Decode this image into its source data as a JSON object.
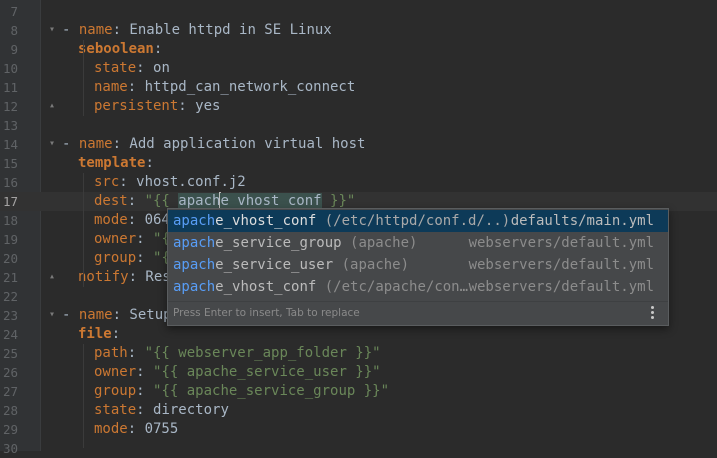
{
  "editor": {
    "lines": [
      {
        "n": "7"
      },
      {
        "n": "8",
        "text": [
          [
            "dash",
            "- "
          ],
          [
            "key",
            "name"
          ],
          [
            "val",
            ": Enable httpd in SE Linux"
          ]
        ]
      },
      {
        "n": "9",
        "text": [
          [
            "kbold",
            "seboolean"
          ],
          [
            "val",
            ":"
          ]
        ]
      },
      {
        "n": "10",
        "text": [
          [
            "key",
            "state"
          ],
          [
            "val",
            ": on"
          ]
        ]
      },
      {
        "n": "11",
        "text": [
          [
            "key",
            "name"
          ],
          [
            "val",
            ": httpd_can_network_connect"
          ]
        ]
      },
      {
        "n": "12",
        "text": [
          [
            "key",
            "persistent"
          ],
          [
            "val",
            ": yes"
          ]
        ]
      },
      {
        "n": "13"
      },
      {
        "n": "14",
        "text": [
          [
            "dash",
            "- "
          ],
          [
            "key",
            "name"
          ],
          [
            "val",
            ": Add application virtual host"
          ]
        ]
      },
      {
        "n": "15",
        "text": [
          [
            "kbold",
            "template"
          ],
          [
            "val",
            ":"
          ]
        ]
      },
      {
        "n": "16",
        "text": [
          [
            "key",
            "src"
          ],
          [
            "val",
            ": vhost.conf.j2"
          ]
        ]
      },
      {
        "n": "17",
        "text": [
          [
            "key",
            "dest"
          ],
          [
            "val",
            ": "
          ],
          [
            "str",
            "\"{{ "
          ],
          [
            "hl",
            "apach"
          ],
          [
            "caret",
            ""
          ],
          [
            "hl",
            "e_vhost_conf"
          ],
          [
            "str",
            " }}\""
          ]
        ]
      },
      {
        "n": "18",
        "text": [
          [
            "key",
            "mode"
          ],
          [
            "val",
            ": 064"
          ]
        ]
      },
      {
        "n": "19",
        "text": [
          [
            "key",
            "owner"
          ],
          [
            "val",
            ": "
          ],
          [
            "str",
            "\"{"
          ]
        ]
      },
      {
        "n": "20",
        "text": [
          [
            "key",
            "group"
          ],
          [
            "val",
            ": "
          ],
          [
            "str",
            "\"{"
          ]
        ]
      },
      {
        "n": "21",
        "text": [
          [
            "key",
            "notify"
          ],
          [
            "val",
            ": Res"
          ]
        ]
      },
      {
        "n": "22"
      },
      {
        "n": "23",
        "text": [
          [
            "dash",
            "- "
          ],
          [
            "key",
            "name"
          ],
          [
            "val",
            ": Setup"
          ]
        ]
      },
      {
        "n": "24",
        "text": [
          [
            "kbold",
            "file"
          ],
          [
            "val",
            ":"
          ]
        ]
      },
      {
        "n": "25",
        "text": [
          [
            "key",
            "path"
          ],
          [
            "val",
            ": "
          ],
          [
            "str",
            "\"{{ webserver_app_folder }}\""
          ]
        ]
      },
      {
        "n": "26",
        "text": [
          [
            "key",
            "owner"
          ],
          [
            "val",
            ": "
          ],
          [
            "str",
            "\"{{ apache_service_user }}\""
          ]
        ]
      },
      {
        "n": "27",
        "text": [
          [
            "key",
            "group"
          ],
          [
            "val",
            ": "
          ],
          [
            "str",
            "\"{{ apache_service_group }}\""
          ]
        ]
      },
      {
        "n": "28",
        "text": [
          [
            "key",
            "state"
          ],
          [
            "val",
            ": directory"
          ]
        ]
      },
      {
        "n": "29",
        "text": [
          [
            "key",
            "mode"
          ],
          [
            "val",
            ": 0755"
          ]
        ]
      },
      {
        "n": "30"
      }
    ]
  },
  "autocomplete": {
    "typed_prefix": "apach",
    "items": [
      {
        "match": "apach",
        "rest": "e_vhost_conf",
        "tail": "(/etc/httpd/conf.d/..)",
        "source": "defaults/main.yml",
        "selected": true
      },
      {
        "match": "apach",
        "rest": "e_service_group",
        "tail": "(apache)",
        "source": "webservers/default.yml",
        "selected": false
      },
      {
        "match": "apach",
        "rest": "e_service_user",
        "tail": "(apache)",
        "source": "webservers/default.yml",
        "selected": false
      },
      {
        "match": "apach",
        "rest": "e_vhost_conf",
        "tail": "(/etc/apache/con…",
        "source": "webservers/default.yml",
        "selected": false
      }
    ],
    "hint": "Press Enter to insert, Tab to replace"
  },
  "icons": {
    "fold_marker": "fold-arrow-icon",
    "popup_menu": "kebab-menu-icon"
  },
  "colors": {
    "background": "#2b2b2b",
    "key": "#cc7832",
    "string": "#6a8759",
    "text": "#a9b7c6",
    "match": "#589df6",
    "selection": "#0d3a58"
  }
}
